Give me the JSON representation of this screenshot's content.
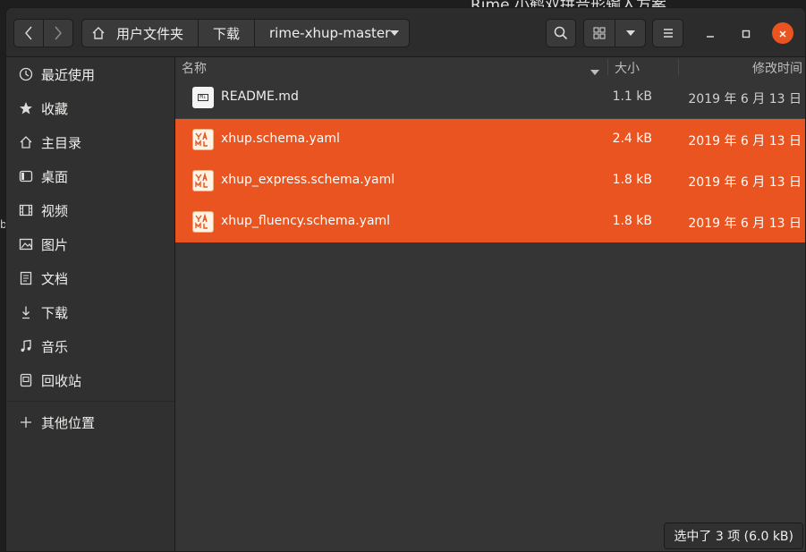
{
  "background": {
    "title": "Rime 小鹤双拼音形输入方案",
    "fragment": "b"
  },
  "colors": {
    "accent": "#e95420",
    "window_bg": "#353535",
    "sidebar_bg": "#303030",
    "header_bg": "#2c2c2c"
  },
  "header": {
    "breadcrumb": [
      "用户文件夹",
      "下载",
      "rime-xhup-master"
    ],
    "icons": {
      "back": "chevron-left-icon",
      "forward": "chevron-right-icon",
      "home": "home-icon",
      "path_menu": "caret-down-icon",
      "search": "search-icon",
      "view": "grid-view-icon",
      "view_menu": "caret-down-icon",
      "menu": "hamburger-menu-icon",
      "minimize": "minimize-icon",
      "maximize": "maximize-icon",
      "close": "close-icon"
    }
  },
  "sidebar": {
    "items": [
      {
        "label": "最近使用",
        "icon": "clock-icon"
      },
      {
        "label": "收藏",
        "icon": "star-icon"
      },
      {
        "label": "主目录",
        "icon": "home-icon"
      },
      {
        "label": "桌面",
        "icon": "desktop-icon"
      },
      {
        "label": "视频",
        "icon": "film-icon"
      },
      {
        "label": "图片",
        "icon": "picture-icon"
      },
      {
        "label": "文档",
        "icon": "document-icon"
      },
      {
        "label": "下载",
        "icon": "download-icon"
      },
      {
        "label": "音乐",
        "icon": "music-icon"
      },
      {
        "label": "回收站",
        "icon": "trash-icon"
      },
      {
        "label": "其他位置",
        "icon": "plus-icon"
      }
    ]
  },
  "columns": {
    "name": "名称",
    "size": "大小",
    "modified": "修改时间"
  },
  "files": [
    {
      "name": "README.md",
      "size": "1.1 kB",
      "modified": "2019 年 6 月 13 日",
      "type": "markdown",
      "selected": false
    },
    {
      "name": "xhup.schema.yaml",
      "size": "2.4 kB",
      "modified": "2019 年 6 月 13 日",
      "type": "yaml",
      "selected": true
    },
    {
      "name": "xhup_express.schema.yaml",
      "size": "1.8 kB",
      "modified": "2019 年 6 月 13 日",
      "type": "yaml",
      "selected": true
    },
    {
      "name": "xhup_fluency.schema.yaml",
      "size": "1.8 kB",
      "modified": "2019 年 6 月 13 日",
      "type": "yaml",
      "selected": true
    }
  ],
  "markdown_icon_text": "M↓",
  "status": "选中了 3 项 (6.0 kB)"
}
